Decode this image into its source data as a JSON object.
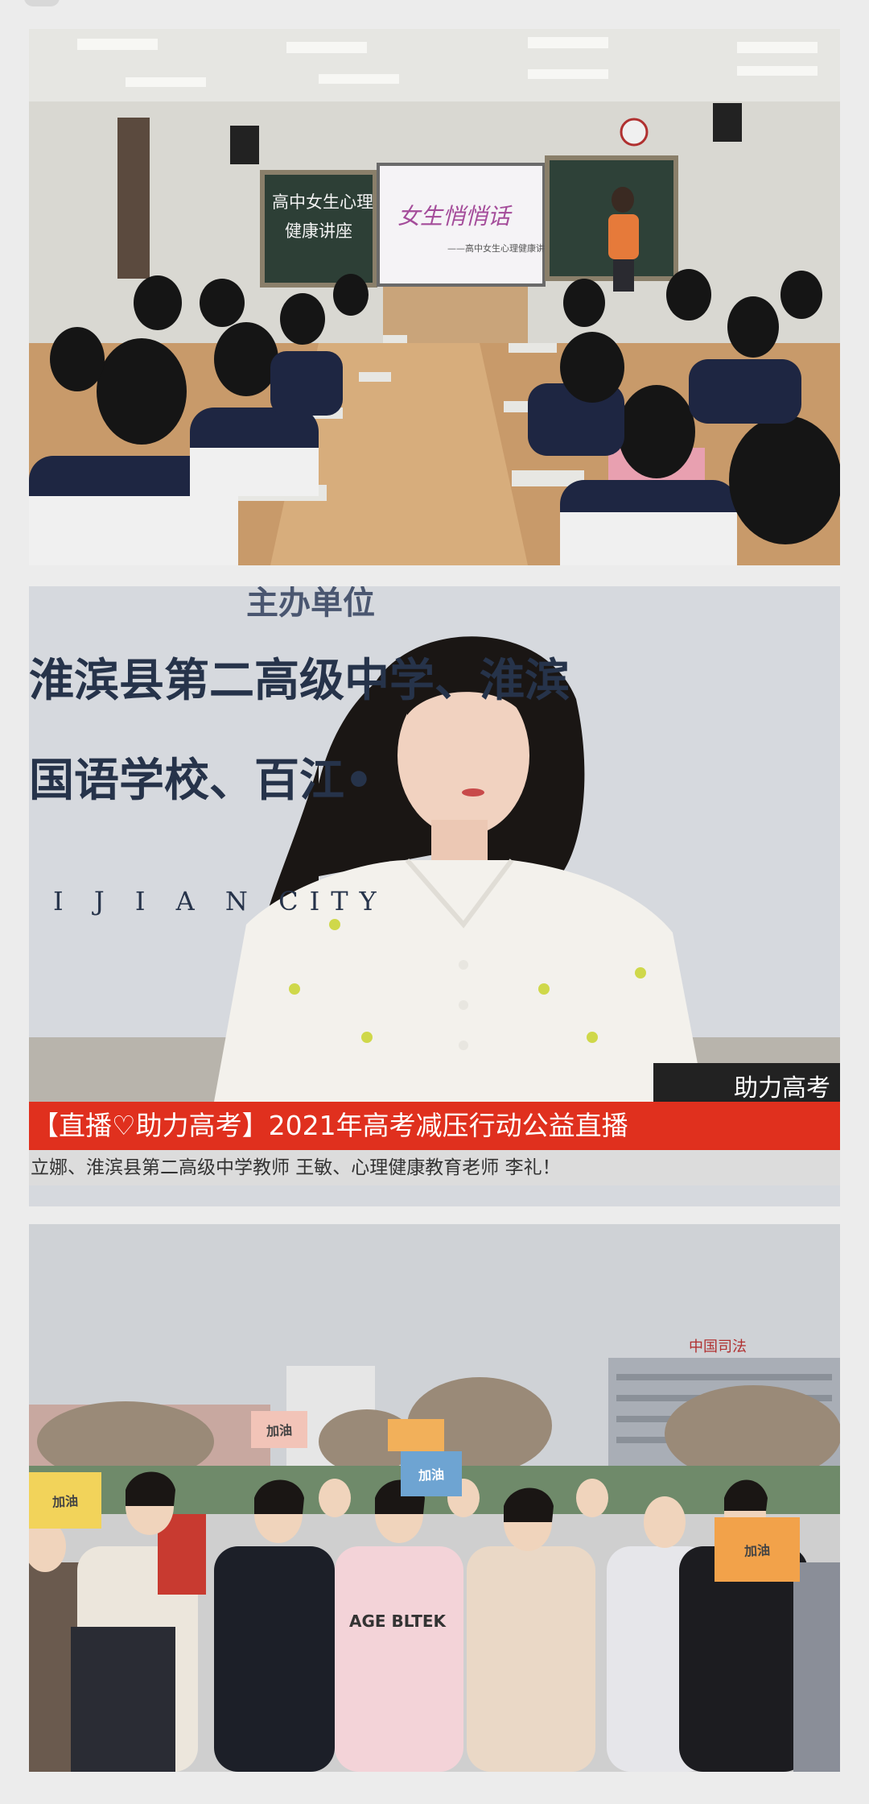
{
  "photos": [
    {
      "id": "classroom-lecture",
      "blackboard_text": "高中女生心理健康讲座",
      "screen_title": "女生悄悄话",
      "screen_subtitle": "——高中女生心理健康讲座"
    },
    {
      "id": "broadcast-teacher",
      "wall_line_1": "主办单位",
      "wall_line_2": "淮滨县第二高级中学、淮滨",
      "wall_line_3": "国语学校、百江•",
      "wall_line_4": "I J I A N   CITY",
      "corner_tag": "助力高考",
      "banner": "【直播♡助力高考】2021年高考减压行动公益直播",
      "ticker": "立娜、淮滨县第二高级中学教师 王敏、心理健康教育老师 李礼！"
    },
    {
      "id": "outdoor-students",
      "building_sign": "中国司法",
      "sign_1": "加油",
      "sign_2": "加油",
      "sign_3": "加油",
      "sign_4": "加油",
      "jacket_text": "AGE BLTEK"
    }
  ],
  "colors": {
    "banner_red": "#e0301e",
    "ticker_gray": "#dcdcdc",
    "page_bg": "#ececec"
  }
}
